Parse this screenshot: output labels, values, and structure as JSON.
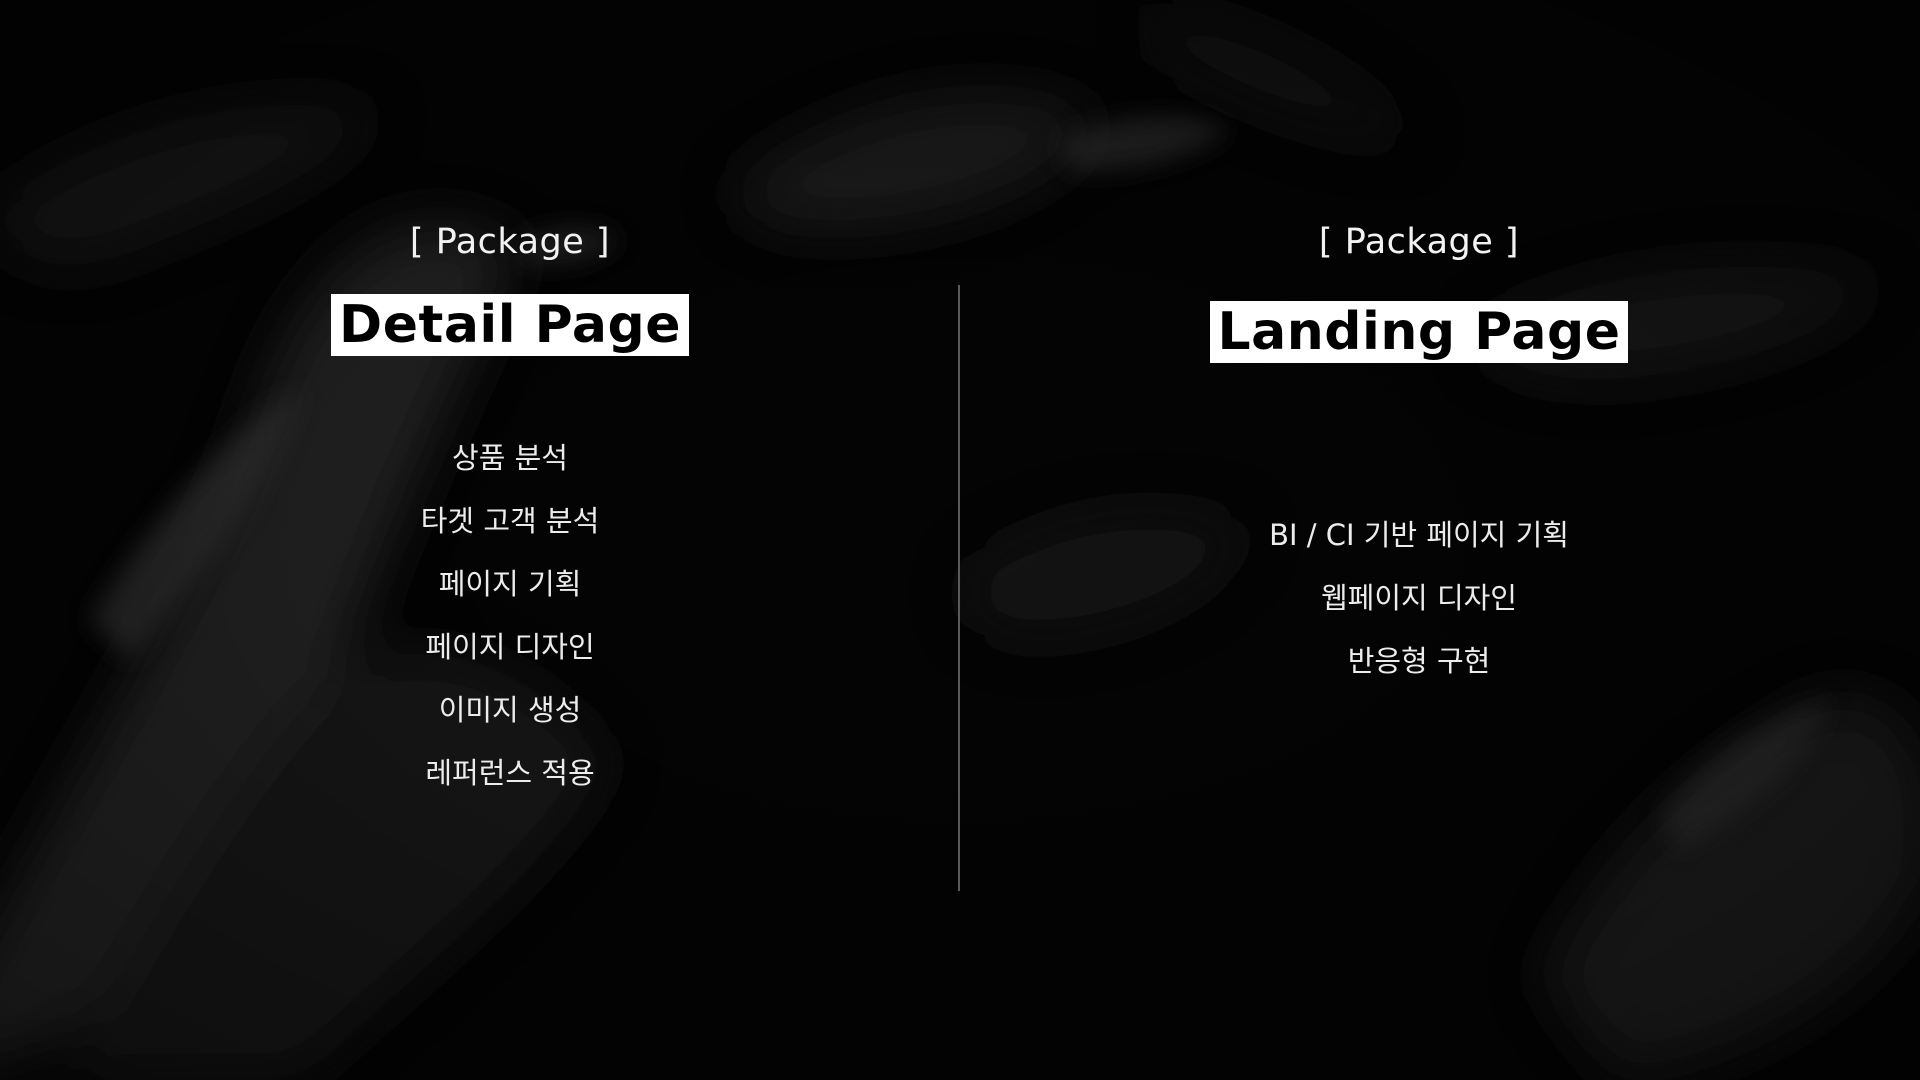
{
  "left_panel": {
    "eyebrow": "[ Package ]",
    "title": "Detail Page",
    "items": [
      "상품 분석",
      "타겟 고객 분석",
      "페이지 기획",
      "페이지 디자인",
      "이미지 생성",
      "레퍼런스 적용"
    ]
  },
  "right_panel": {
    "eyebrow": "[ Package ]",
    "title": "Landing Page",
    "items": [
      "BI / CI 기반 페이지 기획",
      "웹페이지 디자인",
      "반응형 구현"
    ]
  },
  "colors": {
    "background": "#050505",
    "text": "#ffffff",
    "title_highlight_bg": "#ffffff",
    "title_highlight_text": "#000000",
    "divider": "#5a5a5a"
  }
}
